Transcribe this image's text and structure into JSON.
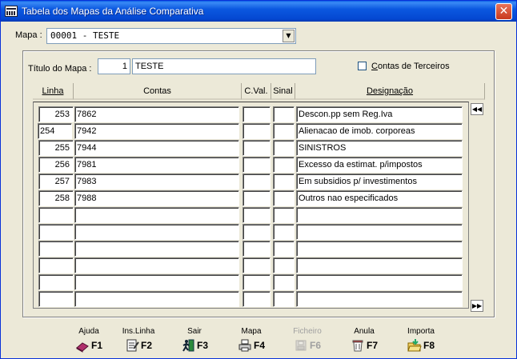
{
  "window": {
    "title": "Tabela dos Mapas da Análise Comparativa",
    "close_glyph": "✕"
  },
  "mapa": {
    "label": "Mapa :",
    "value": "00001 - TESTE",
    "arrow": "▼"
  },
  "titulo": {
    "label": "Título do Mapa :",
    "number": "1",
    "text": "TESTE"
  },
  "terceiros": {
    "label": "Contas de Terceiros",
    "checked": false
  },
  "grid": {
    "headers": [
      "Linha",
      "Contas",
      "C.Val.",
      "Sinal",
      "Designação"
    ],
    "rows": [
      {
        "linha": "253",
        "contas": "7862",
        "cval": "",
        "sinal": "",
        "designacao": "Descon.pp sem Reg.Iva"
      },
      {
        "linha": "254",
        "contas": "7942",
        "cval": "",
        "sinal": "",
        "designacao": "Alienacao de imob. corporeas"
      },
      {
        "linha": "255",
        "contas": "7944",
        "cval": "",
        "sinal": "",
        "designacao": "SINISTROS"
      },
      {
        "linha": "256",
        "contas": "7981",
        "cval": "",
        "sinal": "",
        "designacao": "Excesso da estimat. p/impostos"
      },
      {
        "linha": "257",
        "contas": "7983",
        "cval": "",
        "sinal": "",
        "designacao": "Em subsidios p/ investimentos"
      },
      {
        "linha": "258",
        "contas": "7988",
        "cval": "",
        "sinal": "",
        "designacao": "Outros nao especificados"
      },
      {
        "linha": "",
        "contas": "",
        "cval": "",
        "sinal": "",
        "designacao": ""
      },
      {
        "linha": "",
        "contas": "",
        "cval": "",
        "sinal": "",
        "designacao": ""
      },
      {
        "linha": "",
        "contas": "",
        "cval": "",
        "sinal": "",
        "designacao": ""
      },
      {
        "linha": "",
        "contas": "",
        "cval": "",
        "sinal": "",
        "designacao": ""
      },
      {
        "linha": "",
        "contas": "",
        "cval": "",
        "sinal": "",
        "designacao": ""
      },
      {
        "linha": "",
        "contas": "",
        "cval": "",
        "sinal": "",
        "designacao": ""
      }
    ],
    "editing_row": 1,
    "nav_first": "◀◀",
    "nav_last": "▶▶"
  },
  "toolbar": [
    {
      "label": "Ajuda",
      "key": "F1",
      "icon": "book-icon",
      "disabled": false
    },
    {
      "label": "Ins.Linha",
      "key": "F2",
      "icon": "insert-line-icon",
      "disabled": false
    },
    {
      "label": "Sair",
      "key": "F3",
      "icon": "exit-icon",
      "disabled": false
    },
    {
      "label": "Mapa",
      "key": "F4",
      "icon": "printer-icon",
      "disabled": false
    },
    {
      "label": "Ficheiro",
      "key": "F6",
      "icon": "file-icon",
      "disabled": true
    },
    {
      "label": "Anula",
      "key": "F7",
      "icon": "trash-icon",
      "disabled": false
    },
    {
      "label": "Importa",
      "key": "F8",
      "icon": "import-folder-icon",
      "disabled": false
    }
  ]
}
